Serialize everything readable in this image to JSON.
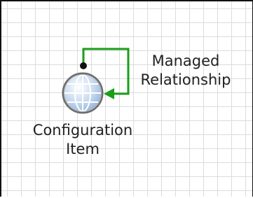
{
  "edge": {
    "label": "Managed\nRelationship",
    "color": "#1a9e1a"
  },
  "node": {
    "label": "Configuration\nItem",
    "icon": "globe-icon"
  }
}
